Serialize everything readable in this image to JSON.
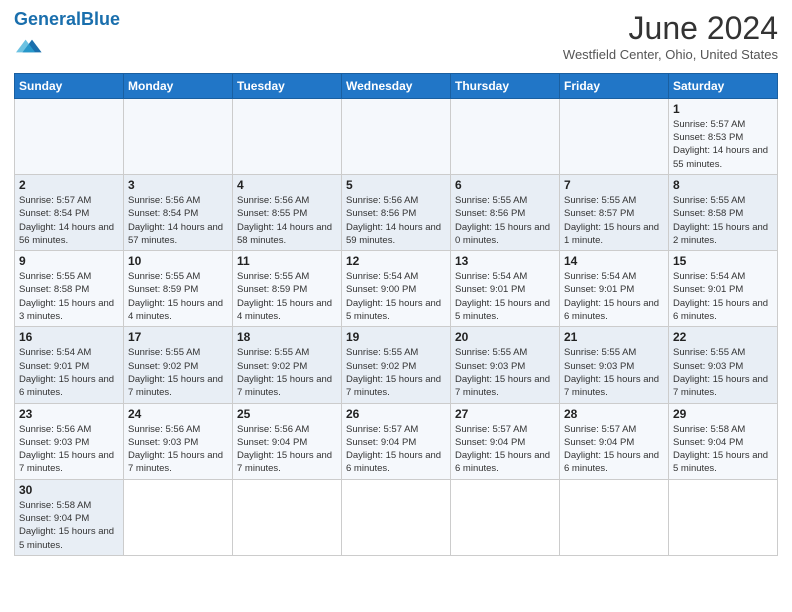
{
  "header": {
    "logo_general": "General",
    "logo_blue": "Blue",
    "month_title": "June 2024",
    "location": "Westfield Center, Ohio, United States"
  },
  "weekdays": [
    "Sunday",
    "Monday",
    "Tuesday",
    "Wednesday",
    "Thursday",
    "Friday",
    "Saturday"
  ],
  "weeks": [
    [
      null,
      null,
      null,
      null,
      null,
      null,
      {
        "day": "1",
        "sunrise": "5:57 AM",
        "sunset": "8:53 PM",
        "daylight": "14 hours and 55 minutes."
      }
    ],
    [
      {
        "day": "2",
        "sunrise": "5:57 AM",
        "sunset": "8:54 PM",
        "daylight": "14 hours and 56 minutes."
      },
      {
        "day": "3",
        "sunrise": "5:56 AM",
        "sunset": "8:54 PM",
        "daylight": "14 hours and 57 minutes."
      },
      {
        "day": "4",
        "sunrise": "5:56 AM",
        "sunset": "8:55 PM",
        "daylight": "14 hours and 58 minutes."
      },
      {
        "day": "5",
        "sunrise": "5:56 AM",
        "sunset": "8:56 PM",
        "daylight": "14 hours and 59 minutes."
      },
      {
        "day": "6",
        "sunrise": "5:55 AM",
        "sunset": "8:56 PM",
        "daylight": "15 hours and 0 minutes."
      },
      {
        "day": "7",
        "sunrise": "5:55 AM",
        "sunset": "8:57 PM",
        "daylight": "15 hours and 1 minute."
      },
      {
        "day": "8",
        "sunrise": "5:55 AM",
        "sunset": "8:58 PM",
        "daylight": "15 hours and 2 minutes."
      }
    ],
    [
      {
        "day": "9",
        "sunrise": "5:55 AM",
        "sunset": "8:58 PM",
        "daylight": "15 hours and 3 minutes."
      },
      {
        "day": "10",
        "sunrise": "5:55 AM",
        "sunset": "8:59 PM",
        "daylight": "15 hours and 4 minutes."
      },
      {
        "day": "11",
        "sunrise": "5:55 AM",
        "sunset": "8:59 PM",
        "daylight": "15 hours and 4 minutes."
      },
      {
        "day": "12",
        "sunrise": "5:54 AM",
        "sunset": "9:00 PM",
        "daylight": "15 hours and 5 minutes."
      },
      {
        "day": "13",
        "sunrise": "5:54 AM",
        "sunset": "9:01 PM",
        "daylight": "15 hours and 5 minutes."
      },
      {
        "day": "14",
        "sunrise": "5:54 AM",
        "sunset": "9:01 PM",
        "daylight": "15 hours and 6 minutes."
      },
      {
        "day": "15",
        "sunrise": "5:54 AM",
        "sunset": "9:01 PM",
        "daylight": "15 hours and 6 minutes."
      }
    ],
    [
      {
        "day": "16",
        "sunrise": "5:54 AM",
        "sunset": "9:01 PM",
        "daylight": "15 hours and 6 minutes."
      },
      {
        "day": "17",
        "sunrise": "5:55 AM",
        "sunset": "9:02 PM",
        "daylight": "15 hours and 7 minutes."
      },
      {
        "day": "18",
        "sunrise": "5:55 AM",
        "sunset": "9:02 PM",
        "daylight": "15 hours and 7 minutes."
      },
      {
        "day": "19",
        "sunrise": "5:55 AM",
        "sunset": "9:02 PM",
        "daylight": "15 hours and 7 minutes."
      },
      {
        "day": "20",
        "sunrise": "5:55 AM",
        "sunset": "9:03 PM",
        "daylight": "15 hours and 7 minutes."
      },
      {
        "day": "21",
        "sunrise": "5:55 AM",
        "sunset": "9:03 PM",
        "daylight": "15 hours and 7 minutes."
      },
      {
        "day": "22",
        "sunrise": "5:55 AM",
        "sunset": "9:03 PM",
        "daylight": "15 hours and 7 minutes."
      }
    ],
    [
      {
        "day": "23",
        "sunrise": "5:56 AM",
        "sunset": "9:03 PM",
        "daylight": "15 hours and 7 minutes."
      },
      {
        "day": "24",
        "sunrise": "5:56 AM",
        "sunset": "9:03 PM",
        "daylight": "15 hours and 7 minutes."
      },
      {
        "day": "25",
        "sunrise": "5:56 AM",
        "sunset": "9:04 PM",
        "daylight": "15 hours and 7 minutes."
      },
      {
        "day": "26",
        "sunrise": "5:57 AM",
        "sunset": "9:04 PM",
        "daylight": "15 hours and 6 minutes."
      },
      {
        "day": "27",
        "sunrise": "5:57 AM",
        "sunset": "9:04 PM",
        "daylight": "15 hours and 6 minutes."
      },
      {
        "day": "28",
        "sunrise": "5:57 AM",
        "sunset": "9:04 PM",
        "daylight": "15 hours and 6 minutes."
      },
      {
        "day": "29",
        "sunrise": "5:58 AM",
        "sunset": "9:04 PM",
        "daylight": "15 hours and 5 minutes."
      }
    ],
    [
      {
        "day": "30",
        "sunrise": "5:58 AM",
        "sunset": "9:04 PM",
        "daylight": "15 hours and 5 minutes."
      },
      null,
      null,
      null,
      null,
      null,
      null
    ]
  ]
}
